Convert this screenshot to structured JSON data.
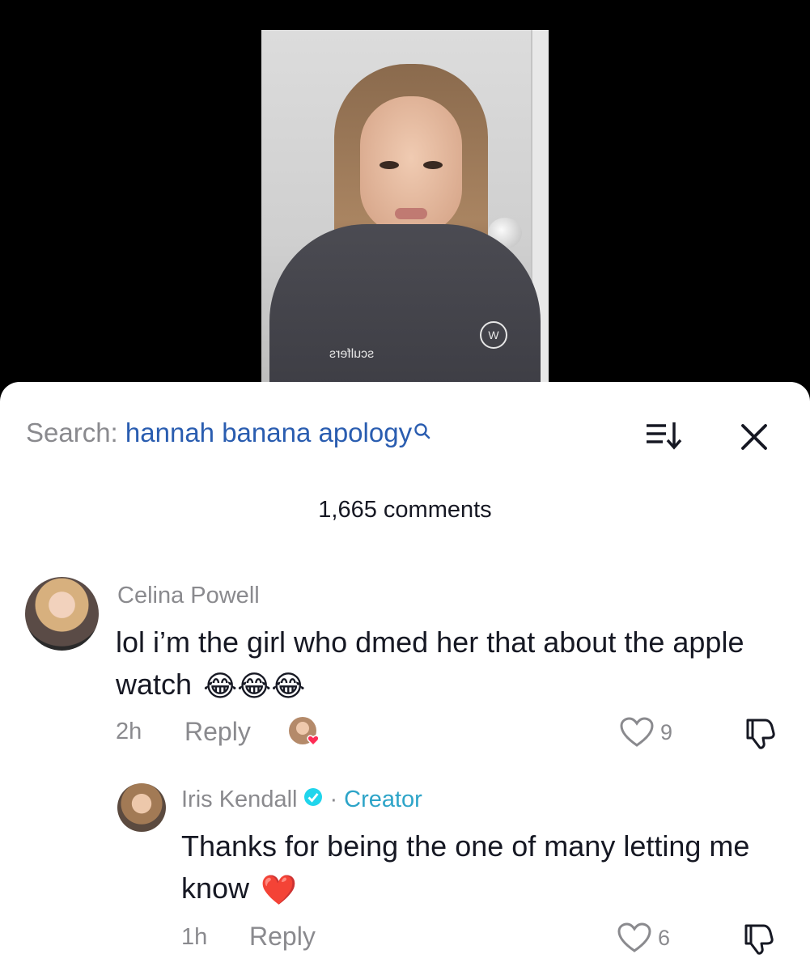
{
  "search": {
    "label": "Search:",
    "query": "hannah banana apology"
  },
  "comments_count": "1,665 comments",
  "comments": [
    {
      "username": "Celina Powell",
      "text": "lol i’m the girl who dmed her that about the apple watch",
      "emoji": "😂😂😂",
      "time": "2h",
      "reply_label": "Reply",
      "likes": "9"
    }
  ],
  "reply": {
    "username": "Iris Kendall",
    "separator": "·",
    "badge": "Creator",
    "text": "Thanks for being the one of many letting me know",
    "emoji": "❤️",
    "time": "1h",
    "reply_label": "Reply",
    "likes": "6"
  },
  "video": {
    "logo_text": "sculfers"
  },
  "colors": {
    "query": "#2a5db0",
    "creator_badge": "#2da4c8",
    "verified": "#20d5ec",
    "heart_badge": "#fe2c55"
  },
  "icons": [
    "search-icon",
    "sort-icon",
    "close-icon",
    "heart-icon",
    "dislike-icon",
    "verified-icon"
  ]
}
